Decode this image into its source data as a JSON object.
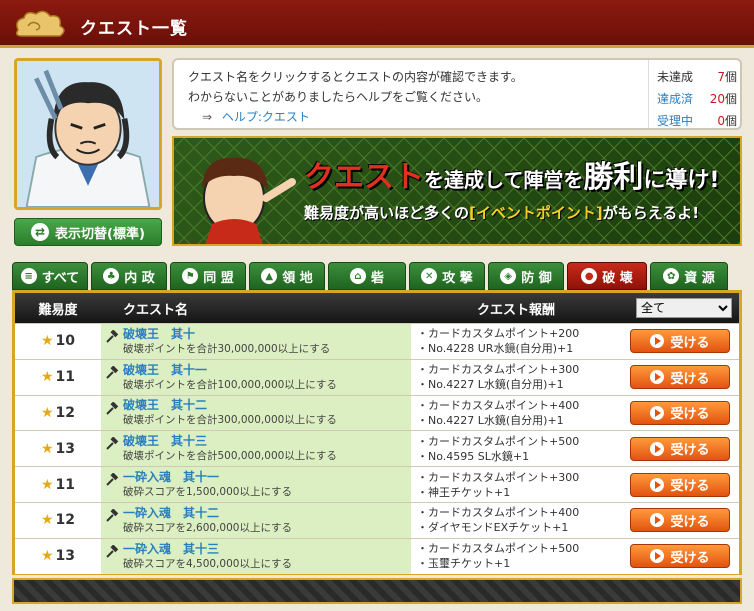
{
  "header": {
    "title": "クエスト一覧"
  },
  "sidebar": {
    "toggle_label": "表示切替(標準)",
    "toggle_icon": "swap-icon"
  },
  "info": {
    "line1": "クエスト名をクリックするとクエストの内容が確認できます。",
    "line2": "わからないことがありましたらヘルプをご覧ください。",
    "help_arrow": "⇒",
    "help_link": "ヘルプ:クエスト",
    "stats": [
      {
        "label": "未達成",
        "value": "7",
        "unit": "個"
      },
      {
        "label": "達成済",
        "value": "20",
        "unit": "個"
      },
      {
        "label": "受理中",
        "value": "0",
        "unit": "個"
      }
    ]
  },
  "banner": {
    "title_red": "クエスト",
    "title_a": "を達成して陣営を",
    "title_b": "勝利",
    "title_c": "に導け!",
    "sub_a": "難易度が高いほど多くの",
    "sub_hl": "[イベントポイント]",
    "sub_b": "がもらえるよ!"
  },
  "tabs": [
    {
      "label": "すべて",
      "icon": "list-icon",
      "active": false
    },
    {
      "label": "内 政",
      "icon": "domestic-icon",
      "active": false
    },
    {
      "label": "同 盟",
      "icon": "flag-icon",
      "active": false
    },
    {
      "label": "領 地",
      "icon": "territory-icon",
      "active": false
    },
    {
      "label": "砦",
      "icon": "fort-icon",
      "active": false
    },
    {
      "label": "攻 撃",
      "icon": "swords-icon",
      "active": false
    },
    {
      "label": "防 御",
      "icon": "shield-icon",
      "active": false
    },
    {
      "label": "破 壊",
      "icon": "bomb-icon",
      "active": true
    },
    {
      "label": "資 源",
      "icon": "wheat-icon",
      "active": false
    }
  ],
  "table": {
    "headers": {
      "difficulty": "難易度",
      "name": "クエスト名",
      "reward": "クエスト報酬"
    },
    "filter_selected": "全て",
    "accept_label": "受ける",
    "rows": [
      {
        "difficulty": "10",
        "name": "破壊王　其十",
        "desc": "破壊ポイントを合計30,000,000以上にする",
        "reward1": "・カードカスタムポイント+200",
        "reward2": "・No.4228 UR水鏡(自分用)+1"
      },
      {
        "difficulty": "11",
        "name": "破壊王　其十一",
        "desc": "破壊ポイントを合計100,000,000以上にする",
        "reward1": "・カードカスタムポイント+300",
        "reward2": "・No.4227 L水鏡(自分用)+1"
      },
      {
        "difficulty": "12",
        "name": "破壊王　其十二",
        "desc": "破壊ポイントを合計300,000,000以上にする",
        "reward1": "・カードカスタムポイント+400",
        "reward2": "・No.4227 L水鏡(自分用)+1"
      },
      {
        "difficulty": "13",
        "name": "破壊王　其十三",
        "desc": "破壊ポイントを合計500,000,000以上にする",
        "reward1": "・カードカスタムポイント+500",
        "reward2": "・No.4595 SL水鏡+1"
      },
      {
        "difficulty": "11",
        "name": "一砕入魂　其十一",
        "desc": "破砕スコアを1,500,000以上にする",
        "reward1": "・カードカスタムポイント+300",
        "reward2": "・神王チケット+1"
      },
      {
        "difficulty": "12",
        "name": "一砕入魂　其十二",
        "desc": "破砕スコアを2,600,000以上にする",
        "reward1": "・カードカスタムポイント+400",
        "reward2": "・ダイヤモンドEXチケット+1"
      },
      {
        "difficulty": "13",
        "name": "一砕入魂　其十三",
        "desc": "破砕スコアを4,500,000以上にする",
        "reward1": "・カードカスタムポイント+500",
        "reward2": "・玉璽チケット+1"
      }
    ]
  },
  "colors": {
    "header_red": "#8c1a10",
    "gold": "#d7a628",
    "tab_green": "#2c7d2c",
    "tab_active": "#c82a1a",
    "accept_orange": "#e2530f",
    "link_blue": "#2a7fc1"
  }
}
